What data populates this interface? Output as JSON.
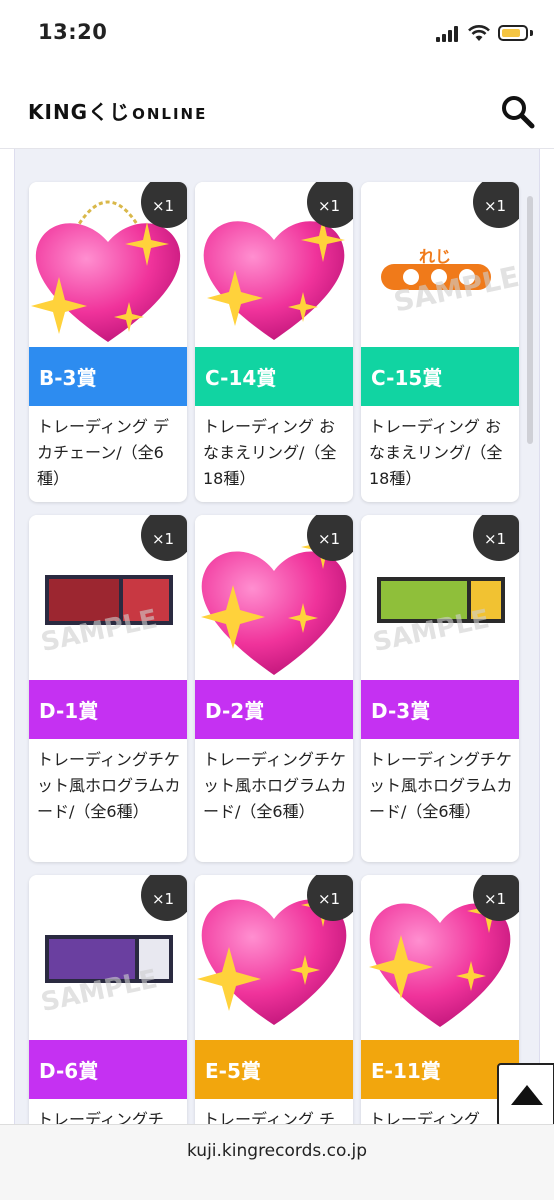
{
  "status_bar": {
    "time": "13:20"
  },
  "header": {
    "logo_main": "KINGくじ",
    "logo_sub": "ONLINE"
  },
  "url_bar": {
    "url": "kuji.kingrecords.co.jp"
  },
  "colors": {
    "blue": "#2d8cf0",
    "green": "#11d4a2",
    "purple": "#c531f2",
    "orange": "#f2a60d"
  },
  "prizes": [
    {
      "label": "B-3賞",
      "name": "トレーディング デカチェーン/（全6種）",
      "qty": "×1",
      "color": "#2d8cf0"
    },
    {
      "label": "C-14賞",
      "name": "トレーディング おなまえリング/（全18種）",
      "qty": "×1",
      "color": "#11d4a2"
    },
    {
      "label": "C-15賞",
      "name": "トレーディング おなまえリング/（全18種）",
      "qty": "×1",
      "color": "#11d4a2"
    },
    {
      "label": "D-1賞",
      "name": "トレーディングチケット風ホログラムカード/（全6種）",
      "qty": "×1",
      "color": "#c531f2"
    },
    {
      "label": "D-2賞",
      "name": "トレーディングチケット風ホログラムカード/（全6種）",
      "qty": "×1",
      "color": "#c531f2"
    },
    {
      "label": "D-3賞",
      "name": "トレーディングチケット風ホログラムカード/（全6種）",
      "qty": "×1",
      "color": "#c531f2"
    },
    {
      "label": "D-6賞",
      "name": "トレーディングチ",
      "qty": "×1",
      "color": "#c531f2"
    },
    {
      "label": "E-5賞",
      "name": "トレーディング チ",
      "qty": "×1",
      "color": "#f2a60d"
    },
    {
      "label": "E-11賞",
      "name": "トレーディング ",
      "qty": "×1",
      "color": "#f2a60d"
    }
  ]
}
